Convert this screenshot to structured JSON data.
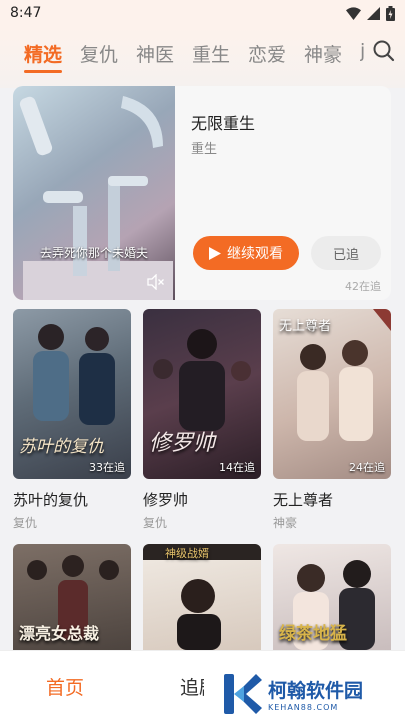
{
  "status_bar": {
    "time": "8:47",
    "icons": [
      "wifi-icon",
      "signal-icon",
      "battery-icon"
    ]
  },
  "tabs": [
    "精选",
    "复仇",
    "神医",
    "重生",
    "恋爱",
    "神豪",
    "j"
  ],
  "active_tab": 0,
  "accent_color": "#f36b24",
  "feature": {
    "subtitle": "去弄死你那个未婚夫",
    "title": "无限重生",
    "genre": "重生",
    "continue_label": "继续观看",
    "followed_label": "已追",
    "follow_count": "42在追"
  },
  "cards": [
    {
      "title": "苏叶的复仇",
      "poster_title": "苏叶的复仇",
      "genre": "复仇",
      "count": "33在追"
    },
    {
      "title": "修罗帅",
      "poster_title": "修罗帅",
      "genre": "复仇",
      "count": "14在追"
    },
    {
      "title": "无上尊者",
      "poster_title": "无上尊者",
      "genre": "神豪",
      "count": "24在追"
    }
  ],
  "row2_posters": [
    {
      "poster_title": "漂亮女总裁"
    },
    {
      "poster_title": "神级战婿"
    },
    {
      "poster_title": "绿茶地猛"
    }
  ],
  "bottom_nav": {
    "home": "首页",
    "follow": "追剧"
  },
  "watermark": {
    "name": "柯翰软件园",
    "domain": "KEHAN88.COM"
  }
}
